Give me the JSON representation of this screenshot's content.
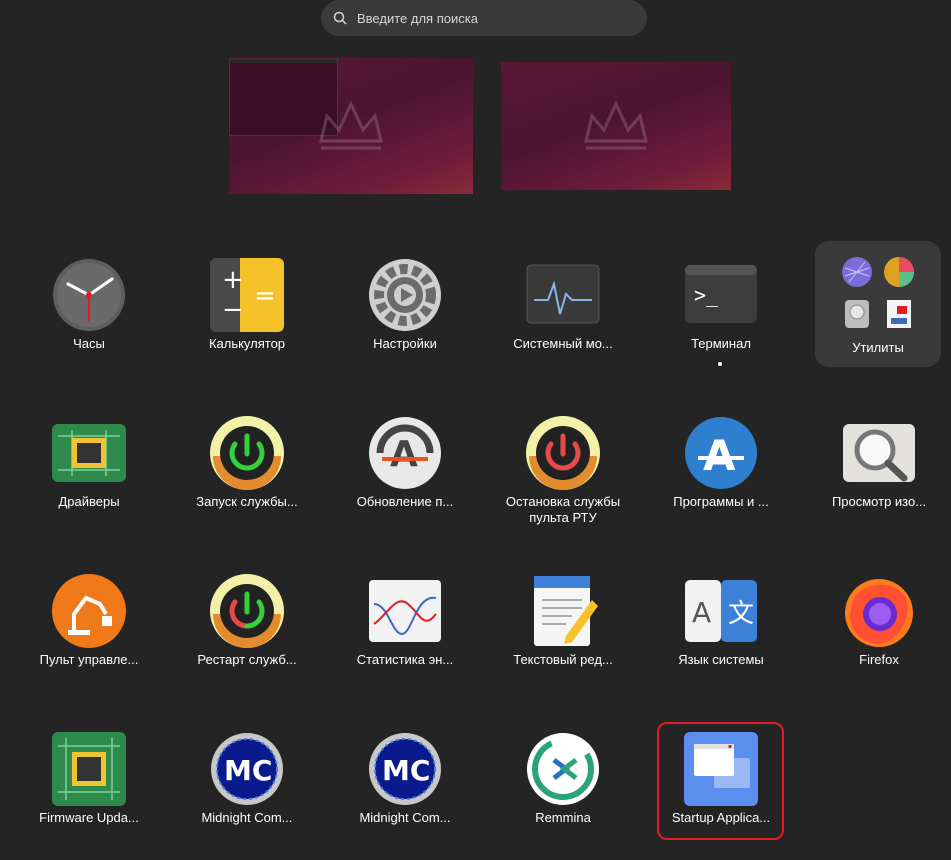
{
  "search": {
    "placeholder": "Введите для поиска",
    "icon": "search-icon"
  },
  "apps": [
    {
      "label": "Часы",
      "icon": "clock-icon"
    },
    {
      "label": "Калькулятор",
      "icon": "calculator-icon"
    },
    {
      "label": "Настройки",
      "icon": "settings-gear-icon"
    },
    {
      "label": "Системный мо...",
      "icon": "system-monitor-icon"
    },
    {
      "label": "Терминал",
      "icon": "terminal-icon",
      "running": true
    },
    {
      "label": "Драйверы",
      "icon": "chip-icon"
    },
    {
      "label": "Запуск службы...",
      "icon": "power-start-icon"
    },
    {
      "label": "Обновление п...",
      "icon": "software-updater-icon"
    },
    {
      "label": "Остановка службы пульта РТУ",
      "icon": "power-stop-icon"
    },
    {
      "label": "Программы и ...",
      "icon": "software-store-icon"
    },
    {
      "label": "Просмотр изо...",
      "icon": "image-viewer-icon"
    },
    {
      "label": "Пульт управле...",
      "icon": "robot-arm-icon"
    },
    {
      "label": "Рестарт служб...",
      "icon": "power-restart-icon"
    },
    {
      "label": "Статистика эн...",
      "icon": "power-statistics-icon"
    },
    {
      "label": "Текстовый ред...",
      "icon": "text-editor-icon"
    },
    {
      "label": "Язык системы",
      "icon": "language-icon"
    },
    {
      "label": "Firefox",
      "icon": "firefox-icon"
    },
    {
      "label": "Firmware Upda...",
      "icon": "firmware-chip-icon"
    },
    {
      "label": "Midnight Com...",
      "icon": "midnight-commander-icon"
    },
    {
      "label": "Midnight Com...",
      "icon": "midnight-commander-icon"
    },
    {
      "label": "Remmina",
      "icon": "remmina-icon"
    },
    {
      "label": "Startup Applica...",
      "icon": "startup-applications-icon",
      "highlighted": true
    }
  ],
  "folder": {
    "label": "Утилиты",
    "icon": "utilities-folder-icon"
  },
  "colors": {
    "background": "#242424",
    "highlight": "#e01b24",
    "wallpaper": "#5a1836"
  }
}
